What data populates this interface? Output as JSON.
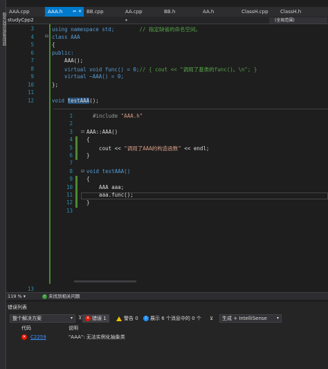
{
  "left_strip": {
    "label": "服务器资源管理器"
  },
  "tabs": [
    {
      "label": "AAA.cpp",
      "active": false
    },
    {
      "label": "AAA.h",
      "active": true
    },
    {
      "label": "BB.cpp",
      "active": false
    },
    {
      "label": "AA.cpp",
      "active": false
    },
    {
      "label": "BB.h",
      "active": false
    },
    {
      "label": "AA.h",
      "active": false
    },
    {
      "label": "ClassH.cpp",
      "active": false
    },
    {
      "label": "ClassH.h",
      "active": false
    }
  ],
  "nav": {
    "project": "studyCpp2",
    "scope": "(全局范围)"
  },
  "editor": {
    "lines": [
      {
        "n": "3",
        "parts": [
          {
            "t": "using namespace std;",
            "c": "kw"
          },
          {
            "t": "        // 指定缺省的命名空间。",
            "c": "cm"
          }
        ]
      },
      {
        "n": "4",
        "parts": [
          {
            "t": "class AAA",
            "c": "kw"
          }
        ]
      },
      {
        "n": "5",
        "parts": [
          {
            "t": "{",
            "c": ""
          }
        ]
      },
      {
        "n": "6",
        "parts": [
          {
            "t": "public:",
            "c": "kw"
          }
        ]
      },
      {
        "n": "7",
        "parts": [
          {
            "t": "    AAA();",
            "c": ""
          }
        ]
      },
      {
        "n": "8",
        "parts": [
          {
            "t": "    virtual void func() = 0;",
            "c": "kw"
          },
          {
            "t": "// { cout << \"调用了基类的func()。\\n\"; }",
            "c": "cm"
          }
        ]
      },
      {
        "n": "9",
        "parts": [
          {
            "t": "    virtual ~AAA() = 0;",
            "c": "kw"
          }
        ]
      },
      {
        "n": "10",
        "parts": [
          {
            "t": "};",
            "c": ""
          }
        ]
      },
      {
        "n": "11",
        "parts": [
          {
            "t": "",
            "c": ""
          }
        ]
      },
      {
        "n": "12",
        "parts": [
          {
            "t": "void ",
            "c": "kw"
          },
          {
            "t": "testAAA",
            "c": "hl"
          },
          {
            "t": "();",
            "c": ""
          }
        ]
      }
    ],
    "last_line": "13"
  },
  "peek": {
    "lines": [
      {
        "n": "1",
        "parts": [
          {
            "t": "  #include ",
            "c": "pp"
          },
          {
            "t": "\"AAA.h\"",
            "c": "str"
          }
        ]
      },
      {
        "n": "2",
        "parts": [
          {
            "t": "",
            "c": ""
          }
        ]
      },
      {
        "n": "3",
        "parts": [
          {
            "t": "AAA::AAA()",
            "c": ""
          }
        ]
      },
      {
        "n": "4",
        "parts": [
          {
            "t": "{",
            "c": ""
          }
        ]
      },
      {
        "n": "5",
        "parts": [
          {
            "t": "    cout << ",
            "c": ""
          },
          {
            "t": "\"调用了AAA的构造函数\"",
            "c": "str"
          },
          {
            "t": " << endl;",
            "c": ""
          }
        ]
      },
      {
        "n": "6",
        "parts": [
          {
            "t": "}",
            "c": ""
          }
        ]
      },
      {
        "n": "7",
        "parts": [
          {
            "t": "",
            "c": ""
          }
        ]
      },
      {
        "n": "8",
        "parts": [
          {
            "t": "void testAAA()",
            "c": "kw"
          }
        ]
      },
      {
        "n": "9",
        "parts": [
          {
            "t": "{",
            "c": ""
          }
        ]
      },
      {
        "n": "10",
        "parts": [
          {
            "t": "    AAA aaa;",
            "c": ""
          }
        ]
      },
      {
        "n": "11",
        "parts": [
          {
            "t": "    aaa.func();",
            "c": ""
          }
        ]
      },
      {
        "n": "12",
        "parts": [
          {
            "t": "}",
            "c": ""
          }
        ]
      },
      {
        "n": "13",
        "parts": [
          {
            "t": "",
            "c": ""
          }
        ]
      }
    ]
  },
  "status": {
    "zoom": "119 %",
    "zoom_dd": "▾",
    "issues": "未找到相关问题"
  },
  "error_list": {
    "title": "错误列表",
    "scope": "整个解决方案",
    "errors_label": "错误 1",
    "warnings_label": "警告 0",
    "messages_label": "展示 6 个消息中的 0 个",
    "source": "生成 + IntelliSense",
    "columns": {
      "code": "代码",
      "desc": "说明"
    },
    "rows": [
      {
        "code": "C2259",
        "desc": "\"AAA\": 无法实例化抽象类"
      }
    ]
  }
}
